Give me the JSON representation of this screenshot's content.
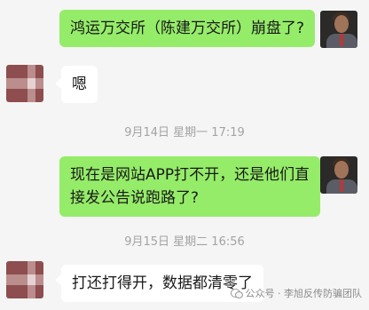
{
  "messages": [
    {
      "side": "right",
      "text_lines": [
        "鸿运万交所（陈建万交所）崩盘了?"
      ]
    },
    {
      "side": "left",
      "text_lines": [
        "嗯"
      ]
    },
    {
      "side": "right",
      "text_lines": [
        "现在是网站APP打不开，还是他们直",
        "接发公告说跑路了?"
      ]
    },
    {
      "side": "left",
      "text_lines": [
        "打还打得开，数据都清零了"
      ]
    }
  ],
  "timestamps": [
    "9月14日 星期一 17:19",
    "9月15日 星期二 16:56"
  ],
  "watermark": {
    "text": "公众号 · 李旭反传防骗团队",
    "icon": "wechat-icon"
  },
  "avatars": {
    "right": "user-avatar-portrait",
    "left": "contact-avatar-pixel"
  },
  "colors": {
    "background": "#f5f5f5",
    "bubble_self": "#95ec69",
    "bubble_other": "#ffffff",
    "timestamp": "#a3a3a3"
  }
}
